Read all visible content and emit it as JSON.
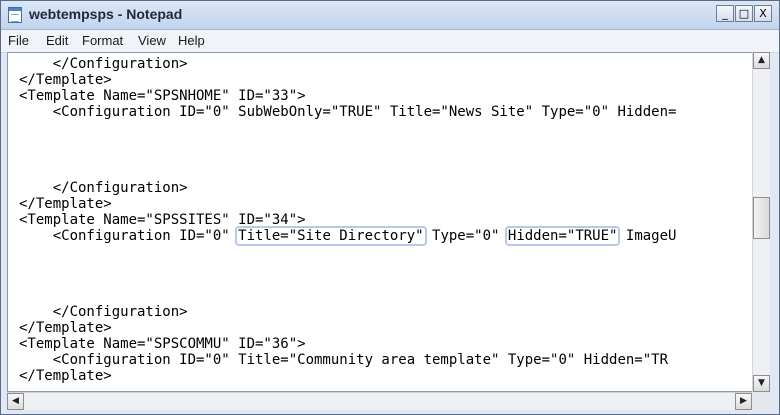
{
  "window": {
    "title": "webtempsps - Notepad",
    "minimize": "_",
    "maximize": "□",
    "close": "X"
  },
  "menu": [
    "File",
    "Edit",
    "Format",
    "View",
    "Help"
  ],
  "editor": {
    "lines": [
      "    </Configuration>",
      "</Template>",
      "<Template Name=\"SPSNHOME\" ID=\"33\">",
      "    <Configuration ID=\"0\" SubWebOnly=\"TRUE\" Title=\"News Site\" Type=\"0\" Hidden=",
      "",
      "",
      "",
      "",
      "    </Configuration>",
      "</Template>",
      "<Template Name=\"SPSSITES\" ID=\"34\">",
      "",
      "",
      "",
      "",
      "",
      "    </Configuration>",
      "</Template>",
      "<Template Name=\"SPSCOMMU\" ID=\"36\">",
      "    <Configuration ID=\"0\" Title=\"Community area template\" Type=\"0\" Hidden=\"TR",
      "</Template>"
    ],
    "highlighted_line": {
      "prefix": "    <Configuration ID=\"0\" ",
      "highlight1": "Title=\"Site Directory\"",
      "middle": " Type=\"0\" ",
      "highlight2": "Hidden=\"TRUE\"",
      "suffix": " ImageU"
    }
  },
  "scrollbars": {
    "up_arrow": "▲",
    "down_arrow": "▼",
    "left_arrow": "◀",
    "right_arrow": "▶"
  }
}
